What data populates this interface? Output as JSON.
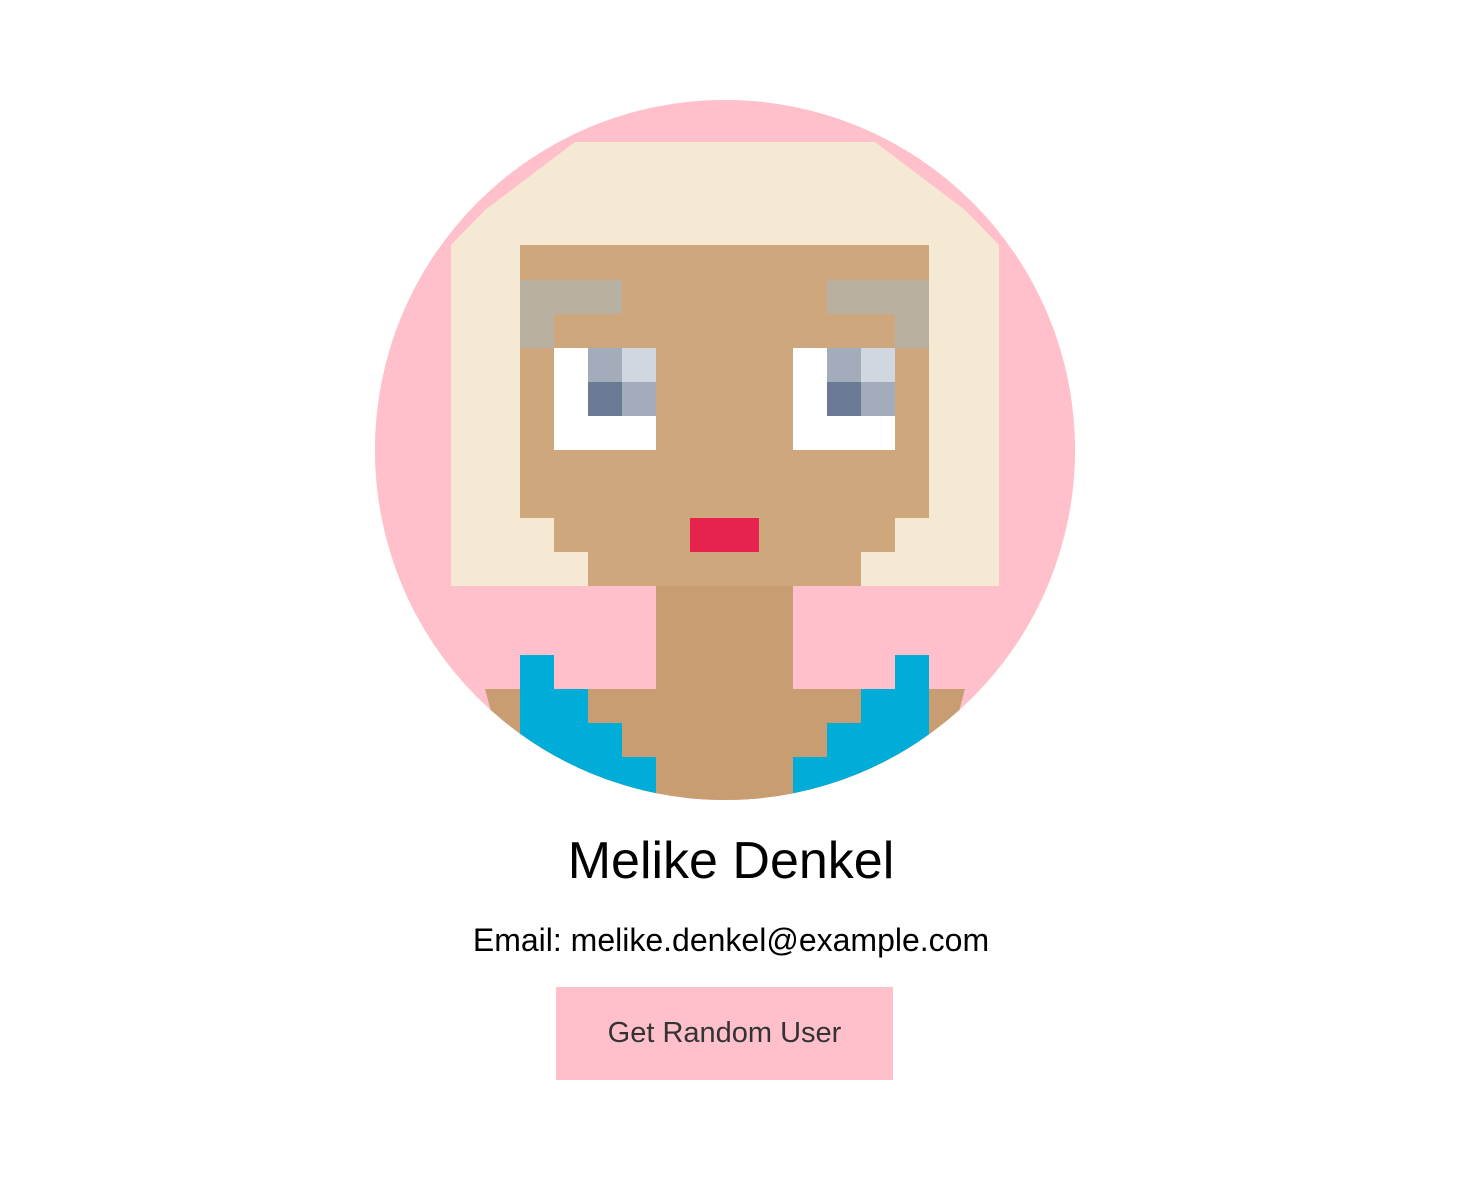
{
  "profile": {
    "name": "Melike Denkel",
    "email_line": "Email: melike.denkel@example.com"
  },
  "actions": {
    "fetch_label": "Get Random User"
  },
  "colors": {
    "background": "#ffffff",
    "accent_pink": "#ffc0cb",
    "hair": "#f5e9d3",
    "skin": "#cfa77c",
    "neck_skin": "#c99d72",
    "eyebrow": "#b8b0a0",
    "eye_white": "#ffffff",
    "iris_light": "#d1d7e0",
    "iris_mid": "#a3acba",
    "iris_dark": "#6b7a94",
    "lips": "#e6224f",
    "shirt": "#00acd8",
    "text": "#000000",
    "button_text": "#333333"
  }
}
